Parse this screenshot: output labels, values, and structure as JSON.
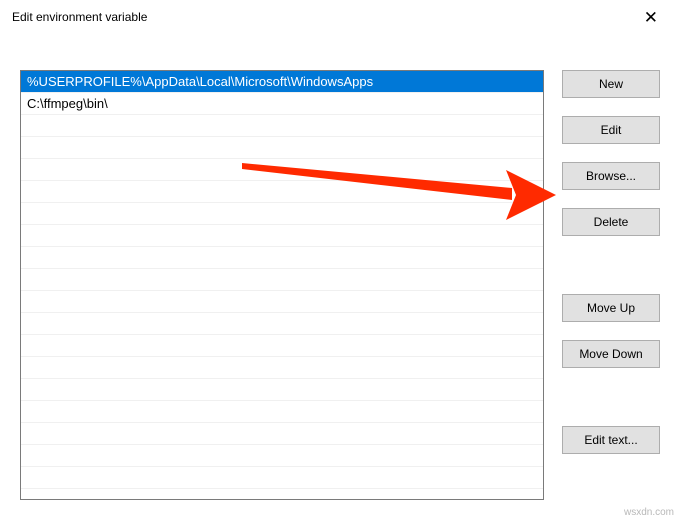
{
  "window": {
    "title": "Edit environment variable",
    "close_glyph": "✕"
  },
  "list": {
    "rows": [
      {
        "text": "%USERPROFILE%\\AppData\\Local\\Microsoft\\WindowsApps",
        "selected": true
      },
      {
        "text": "C:\\ffmpeg\\bin\\",
        "selected": false
      },
      {
        "text": "",
        "selected": false
      },
      {
        "text": "",
        "selected": false
      },
      {
        "text": "",
        "selected": false
      },
      {
        "text": "",
        "selected": false
      },
      {
        "text": "",
        "selected": false
      },
      {
        "text": "",
        "selected": false
      },
      {
        "text": "",
        "selected": false
      },
      {
        "text": "",
        "selected": false
      },
      {
        "text": "",
        "selected": false
      },
      {
        "text": "",
        "selected": false
      },
      {
        "text": "",
        "selected": false
      },
      {
        "text": "",
        "selected": false
      },
      {
        "text": "",
        "selected": false
      },
      {
        "text": "",
        "selected": false
      },
      {
        "text": "",
        "selected": false
      },
      {
        "text": "",
        "selected": false
      },
      {
        "text": "",
        "selected": false
      }
    ]
  },
  "buttons": {
    "new": "New",
    "edit": "Edit",
    "browse": "Browse...",
    "delete": "Delete",
    "move_up": "Move Up",
    "move_down": "Move Down",
    "edit_text": "Edit text..."
  },
  "annotation": {
    "arrow_color": "#ff2a00"
  },
  "watermark": "wsxdn.com"
}
